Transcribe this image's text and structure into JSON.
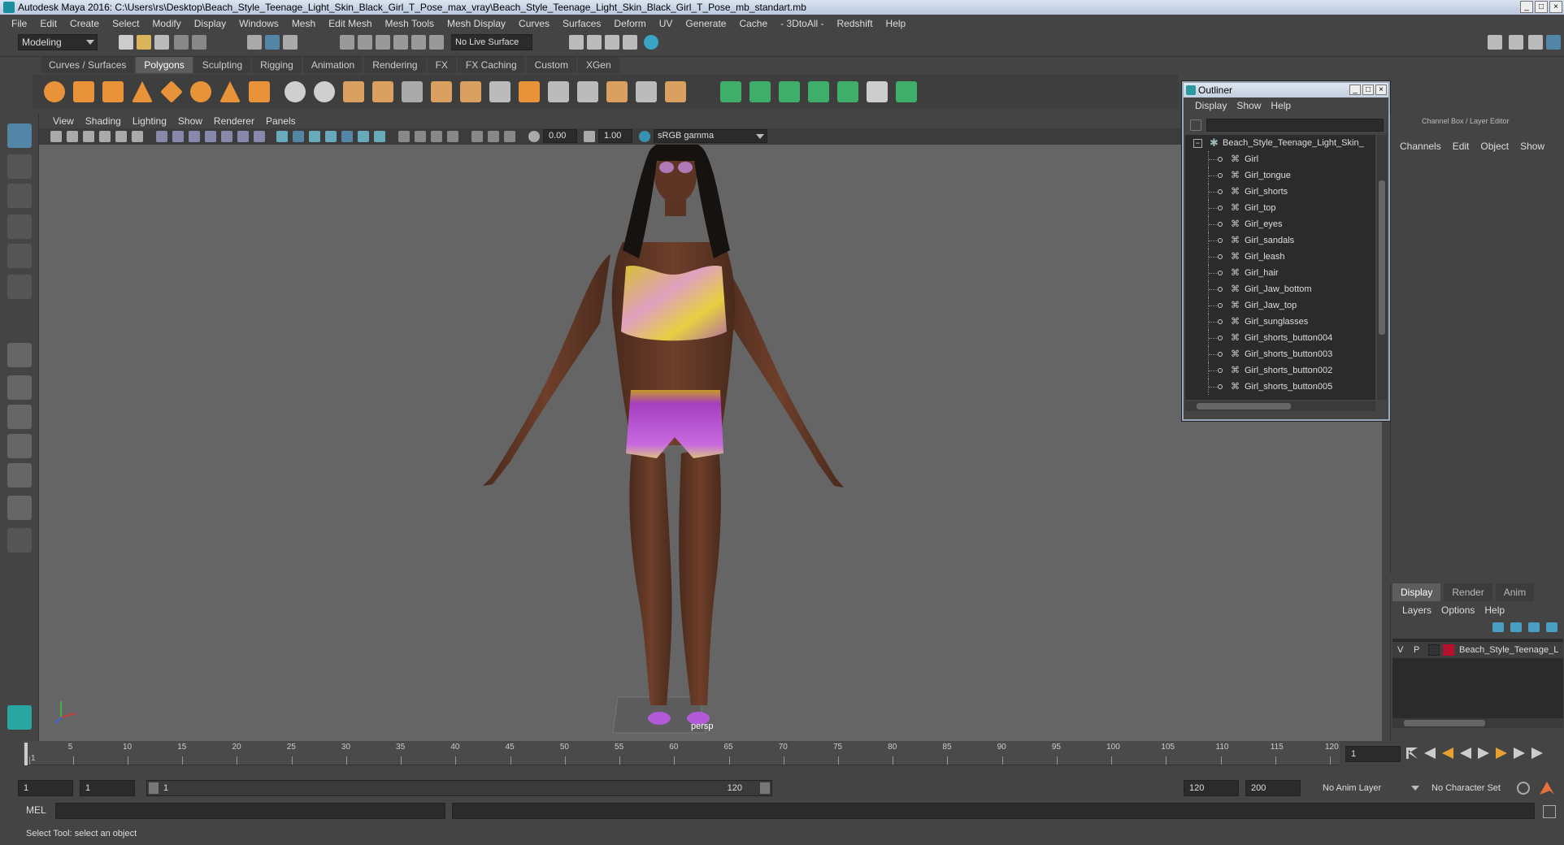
{
  "title": "Autodesk Maya 2016: C:\\Users\\rs\\Desktop\\Beach_Style_Teenage_Light_Skin_Black_Girl_T_Pose_max_vray\\Beach_Style_Teenage_Light_Skin_Black_Girl_T_Pose_mb_standart.mb",
  "menu": [
    "File",
    "Edit",
    "Create",
    "Select",
    "Modify",
    "Display",
    "Windows",
    "Mesh",
    "Edit Mesh",
    "Mesh Tools",
    "Mesh Display",
    "Curves",
    "Surfaces",
    "Deform",
    "UV",
    "Generate",
    "Cache",
    "- 3DtoAll -",
    "Redshift",
    "Help"
  ],
  "status": {
    "mode": "Modeling",
    "live_surface": "No Live Surface"
  },
  "shelf_tabs": [
    "Curves / Surfaces",
    "Polygons",
    "Sculpting",
    "Rigging",
    "Animation",
    "Rendering",
    "FX",
    "FX Caching",
    "Custom",
    "XGen"
  ],
  "active_shelf": "Polygons",
  "panel_menu": [
    "View",
    "Shading",
    "Lighting",
    "Show",
    "Renderer",
    "Panels"
  ],
  "panel_toolbar": {
    "exposure": "0.00",
    "gamma": "1.00",
    "colorspace": "sRGB gamma"
  },
  "viewport": {
    "camera": "persp"
  },
  "outliner": {
    "title": "Outliner",
    "menu": [
      "Display",
      "Show",
      "Help"
    ],
    "root": "Beach_Style_Teenage_Light_Skin_",
    "items": [
      "Girl",
      "Girl_tongue",
      "Girl_shorts",
      "Girl_top",
      "Girl_eyes",
      "Girl_sandals",
      "Girl_leash",
      "Girl_hair",
      "Girl_Jaw_bottom",
      "Girl_Jaw_top",
      "Girl_sunglasses",
      "Girl_shorts_button004",
      "Girl_shorts_button003",
      "Girl_shorts_button002",
      "Girl_shorts_button005"
    ]
  },
  "channel_box": {
    "header": "Channel Box / Layer Editor",
    "menu": [
      "Channels",
      "Edit",
      "Object",
      "Show"
    ]
  },
  "layer_editor": {
    "tabs": [
      "Display",
      "Render",
      "Anim"
    ],
    "menu": [
      "Layers",
      "Options",
      "Help"
    ],
    "layer": {
      "v": "V",
      "p": "P",
      "name": "Beach_Style_Teenage_L",
      "color": "#b8102a"
    }
  },
  "timeline": {
    "ticks": [
      "1",
      "5",
      "10",
      "15",
      "20",
      "25",
      "30",
      "35",
      "40",
      "45",
      "50",
      "55",
      "60",
      "65",
      "70",
      "75",
      "80",
      "85",
      "90",
      "95",
      "100",
      "105",
      "110",
      "115",
      "120"
    ],
    "current_frame": "1"
  },
  "range": {
    "start": "1",
    "start2": "1",
    "slider_start": "1",
    "slider_end": "120",
    "end": "120",
    "end2": "200",
    "anim_layer": "No Anim Layer",
    "char_set": "No Character Set"
  },
  "cmd": {
    "lang": "MEL"
  },
  "help": "Select Tool: select an object",
  "colors": {
    "accent": "#5285a6",
    "viewport": "#656565",
    "panel": "#444444"
  }
}
